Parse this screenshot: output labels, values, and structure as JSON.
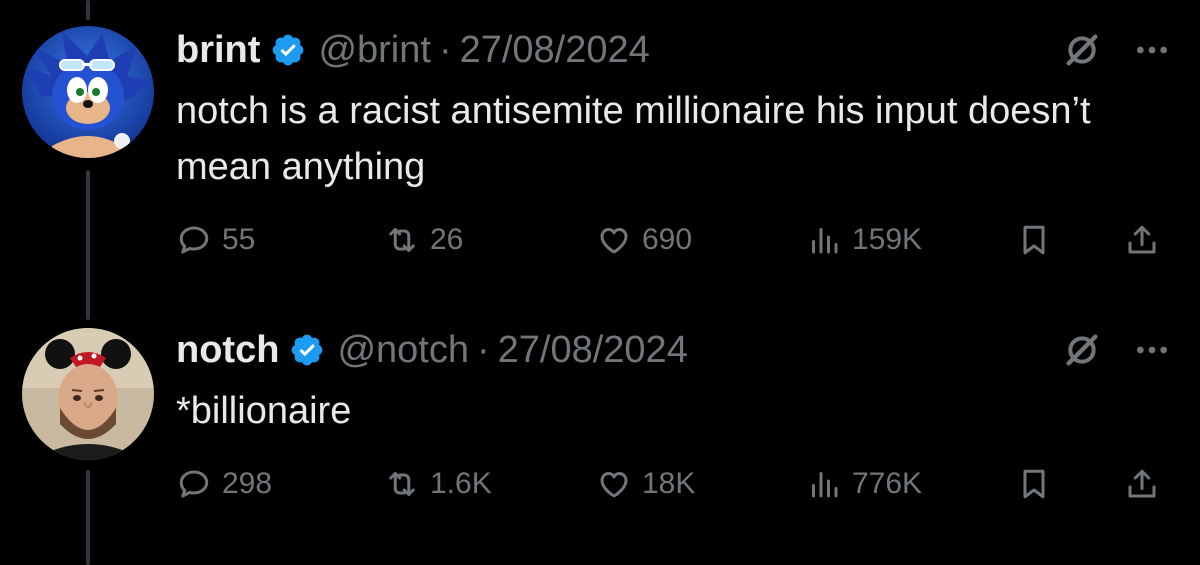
{
  "tweets": [
    {
      "name": "brint",
      "handle": "@brint",
      "separator": "·",
      "date": "27/08/2024",
      "text": "notch is a racist antisemite millionaire his input doesn’t mean anything",
      "replies": "55",
      "reposts": "26",
      "likes": "690",
      "views": "159K"
    },
    {
      "name": "notch",
      "handle": "@notch",
      "separator": "·",
      "date": "27/08/2024",
      "text": "*billionaire",
      "replies": "298",
      "reposts": "1.6K",
      "likes": "18K",
      "views": "776K"
    }
  ],
  "colors": {
    "background": "#000000",
    "text": "#e7e9ea",
    "muted": "#71767b",
    "verified": "#1d9bf0",
    "thread_line": "#333639"
  },
  "icons": [
    "verified-badge-icon",
    "grok-icon",
    "more-icon",
    "reply-icon",
    "repost-icon",
    "like-icon",
    "views-icon",
    "bookmark-icon",
    "share-icon"
  ]
}
